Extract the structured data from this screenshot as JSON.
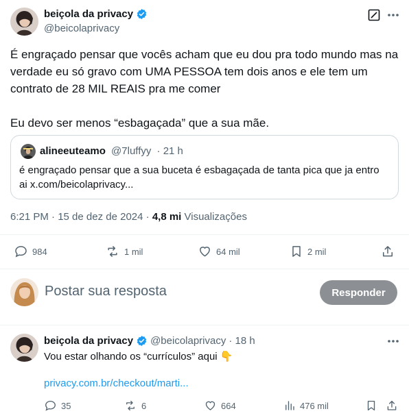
{
  "main_tweet": {
    "author_name": "beiçola da privacy",
    "author_handle": "@beicolaprivacy",
    "text_paragraphs": [
      "É engraçado pensar que vocês acham que eu dou pra todo mundo mas na verdade eu só gravo com UMA PESSOA tem dois anos e ele tem um contrato de 28 MIL REAIS pra me comer",
      "Eu devo ser menos “esbagaçada” que a sua mãe."
    ],
    "timestamp": "6:21 PM · 15 de dez de 2024 · ",
    "views_count": "4,8 mi",
    "views_label": " Visualizações",
    "actions": {
      "replies": "984",
      "reposts": "1 mil",
      "likes": "64 mil",
      "bookmarks": "2 mil"
    }
  },
  "quoted_tweet": {
    "author_name": "alineeuteamo",
    "author_handle": "@7luffyy",
    "time": "· 21 h",
    "text": "é engraçado pensar que a sua buceta é esbagaçada de tanta pica que ja entro ai x.com/beicolaprivacy..."
  },
  "reply_box": {
    "placeholder": "Postar sua resposta",
    "button_label": "Responder"
  },
  "reply_tweet": {
    "author_name": "beiçola da privacy",
    "author_handle": "@beicolaprivacy",
    "time": "· 18 h",
    "text": "Vou estar olhando os “currículos”  aqui 👇",
    "link": "privacy.com.br/checkout/marti...",
    "actions": {
      "replies": "35",
      "reposts": "6",
      "likes": "664",
      "views": "476 mil"
    }
  },
  "colors": {
    "verified": "#1d9bf0",
    "secondary_text": "#536471",
    "link": "#1d9bf0",
    "reply_button_bg": "#8c9094"
  },
  "icons": [
    "verified-badge-icon",
    "grok-icon",
    "more-icon",
    "reply-icon",
    "repost-icon",
    "like-icon",
    "bookmark-icon",
    "share-icon",
    "views-icon"
  ]
}
